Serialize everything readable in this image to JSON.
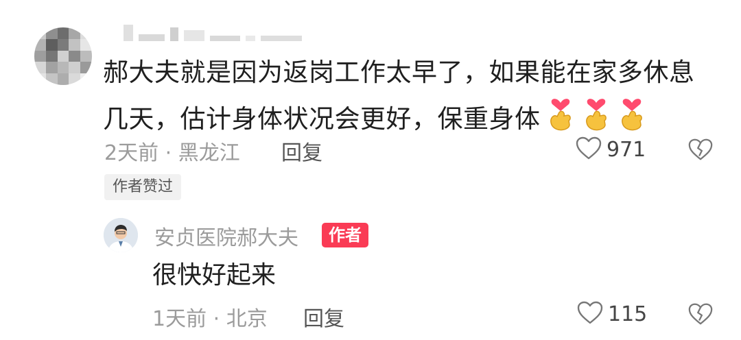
{
  "comment": {
    "line1": "郝大夫就是因为返岗工作太早了，如果能在家多休息",
    "line2": "几天，估计身体状况会更好，保重身体",
    "emoji_icons": [
      "finger-heart-icon",
      "finger-heart-icon",
      "finger-heart-icon"
    ],
    "time_location": "2天前 · 黑龙江",
    "reply_label": "回复",
    "like_count": "971",
    "author_liked_tag": "作者赞过"
  },
  "reply": {
    "author_name": "安贞医院郝大夫",
    "author_badge": "作者",
    "text": "很快好起来",
    "time_location": "1天前 · 北京",
    "reply_label": "回复",
    "like_count": "115"
  },
  "colors": {
    "badge": "#fa3b55",
    "meta_text": "#9b9b9b",
    "body_text": "#1f1f1f"
  }
}
